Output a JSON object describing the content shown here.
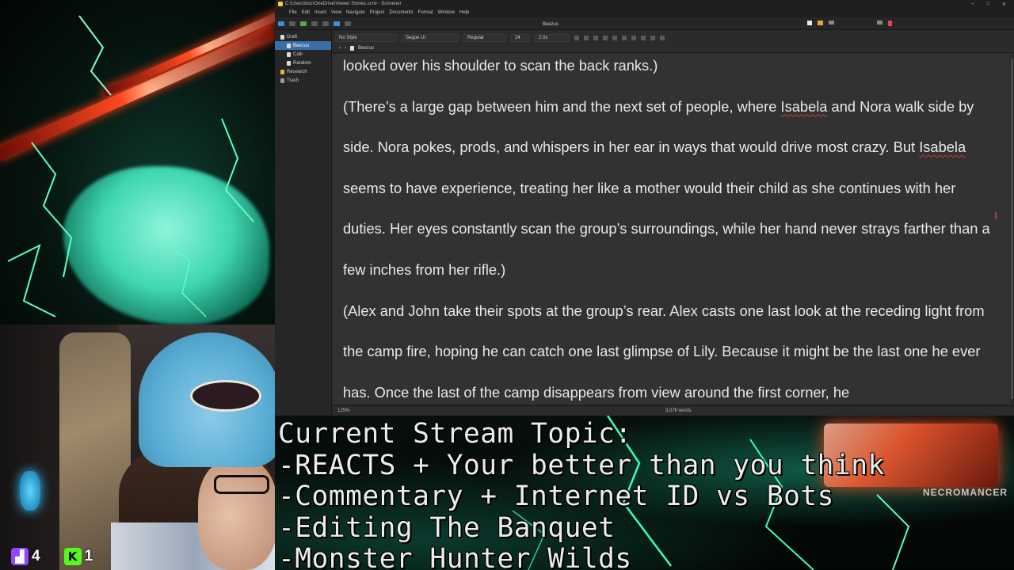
{
  "window": {
    "title": "C:\\Users\\ttoc\\OneDrive\\Viewer Stories.scriv - Scrivener",
    "controls": [
      "–",
      "□",
      "✕"
    ]
  },
  "menu": [
    "File",
    "Edit",
    "Insert",
    "View",
    "Navigate",
    "Project",
    "Documents",
    "Format",
    "Window",
    "Help"
  ],
  "toolbar": {
    "doc_title": "Beezus"
  },
  "binder": {
    "items": [
      {
        "label": "Draft",
        "icon": "draft-icon"
      },
      {
        "label": "Beezus",
        "icon": "document-icon",
        "selected": true
      },
      {
        "label": "Calli",
        "icon": "document-icon"
      },
      {
        "label": "Random",
        "icon": "document-icon"
      },
      {
        "label": "Research",
        "icon": "folder-icon"
      },
      {
        "label": "Trash",
        "icon": "trash-icon"
      }
    ]
  },
  "format_bar": {
    "style": "No Style",
    "font": "Segoe UI",
    "weight": "Regular",
    "size": "24",
    "line_spacing": "2.0x"
  },
  "header_bar": {
    "doc_name": "Beezus"
  },
  "editor": {
    "line0": "looked over his shoulder to scan the back ranks.)",
    "p1_a": "(There’s a large gap between him and the next set of people, where ",
    "p1_isabela": "Isabela",
    "p1_b": " and Nora walk side by side. Nora pokes, prods, and whispers in her ear in ways that would drive most crazy. But ",
    "p1_isabela2": "Isabela",
    "p1_c": " seems to have experience, treating her like a mother would their child as she continues with her duties. Her eyes constantly scan the group’s surroundings, while her hand never strays farther than a few inches from her rifle.)",
    "p2": "(Alex and John take their spots at the group’s rear. Alex casts one last look at the receding light from the camp fire, hoping he can catch one last glimpse of Lily. Because it might be the last one he ever has. Once the last of the camp disappears from view around the first corner, he"
  },
  "footer": {
    "zoom": "125%",
    "word_count": "3,076 words"
  },
  "stream": {
    "topic_lines": [
      "Current Stream Topic:",
      "-REACTS + Your better than you think",
      "-Commentary + Internet ID vs Bots",
      "-Editing The Banquet",
      "-Monster Hunter Wilds"
    ],
    "logo_text": "NECROMANCER",
    "twitch_count": "4",
    "kick_count": "1",
    "twitch_color": "#9146ff",
    "kick_color": "#53fc18"
  }
}
